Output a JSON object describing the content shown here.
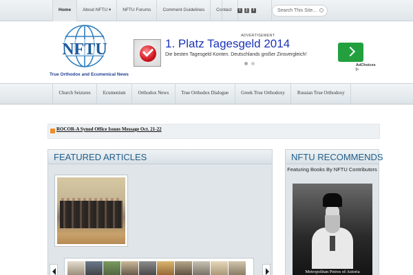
{
  "top_nav": {
    "items": [
      "Home",
      "About NFTU ▾",
      "NFTU Forums",
      "Comment Guidelines",
      "Contact"
    ],
    "active_index": 0
  },
  "social": {
    "icons": [
      "twitter-icon",
      "rss-icon",
      "facebook-icon"
    ]
  },
  "search": {
    "placeholder": "Search This Site..."
  },
  "logo": {
    "text": "NFTU"
  },
  "tagline": "True Orthodox and Ecumenical News",
  "ad": {
    "label": "ADVERTISEMENT",
    "title": "1. Platz Tagesgeld 2014",
    "text": "Die besten Tagesgeld Konten. Deutschlands großer Zinsvergleich!",
    "choices": "AdChoices ▷"
  },
  "category_nav": {
    "items": [
      "Church Seizures",
      "Ecumenism",
      "Orthodox News",
      "True Orthodox Dialogue",
      "Greek True Orthodoxy",
      "Russian True Orthodoxy"
    ]
  },
  "ticker": {
    "headline": "ROCOR-A Synod Office Issues Message Oct. 21-22"
  },
  "featured": {
    "title": "FEATURED ARTICLES"
  },
  "recommends": {
    "title": "NFTU RECOMMENDS",
    "subtitle": "Featuring Books By NFTU Contributors",
    "book_caption": "Metropolitan Petros of Astoria"
  },
  "colors": {
    "accent": "#1f5e8c",
    "tagline": "#1e3d8f",
    "ad_button": "#22a03e",
    "ad_title": "#1a33b8"
  }
}
